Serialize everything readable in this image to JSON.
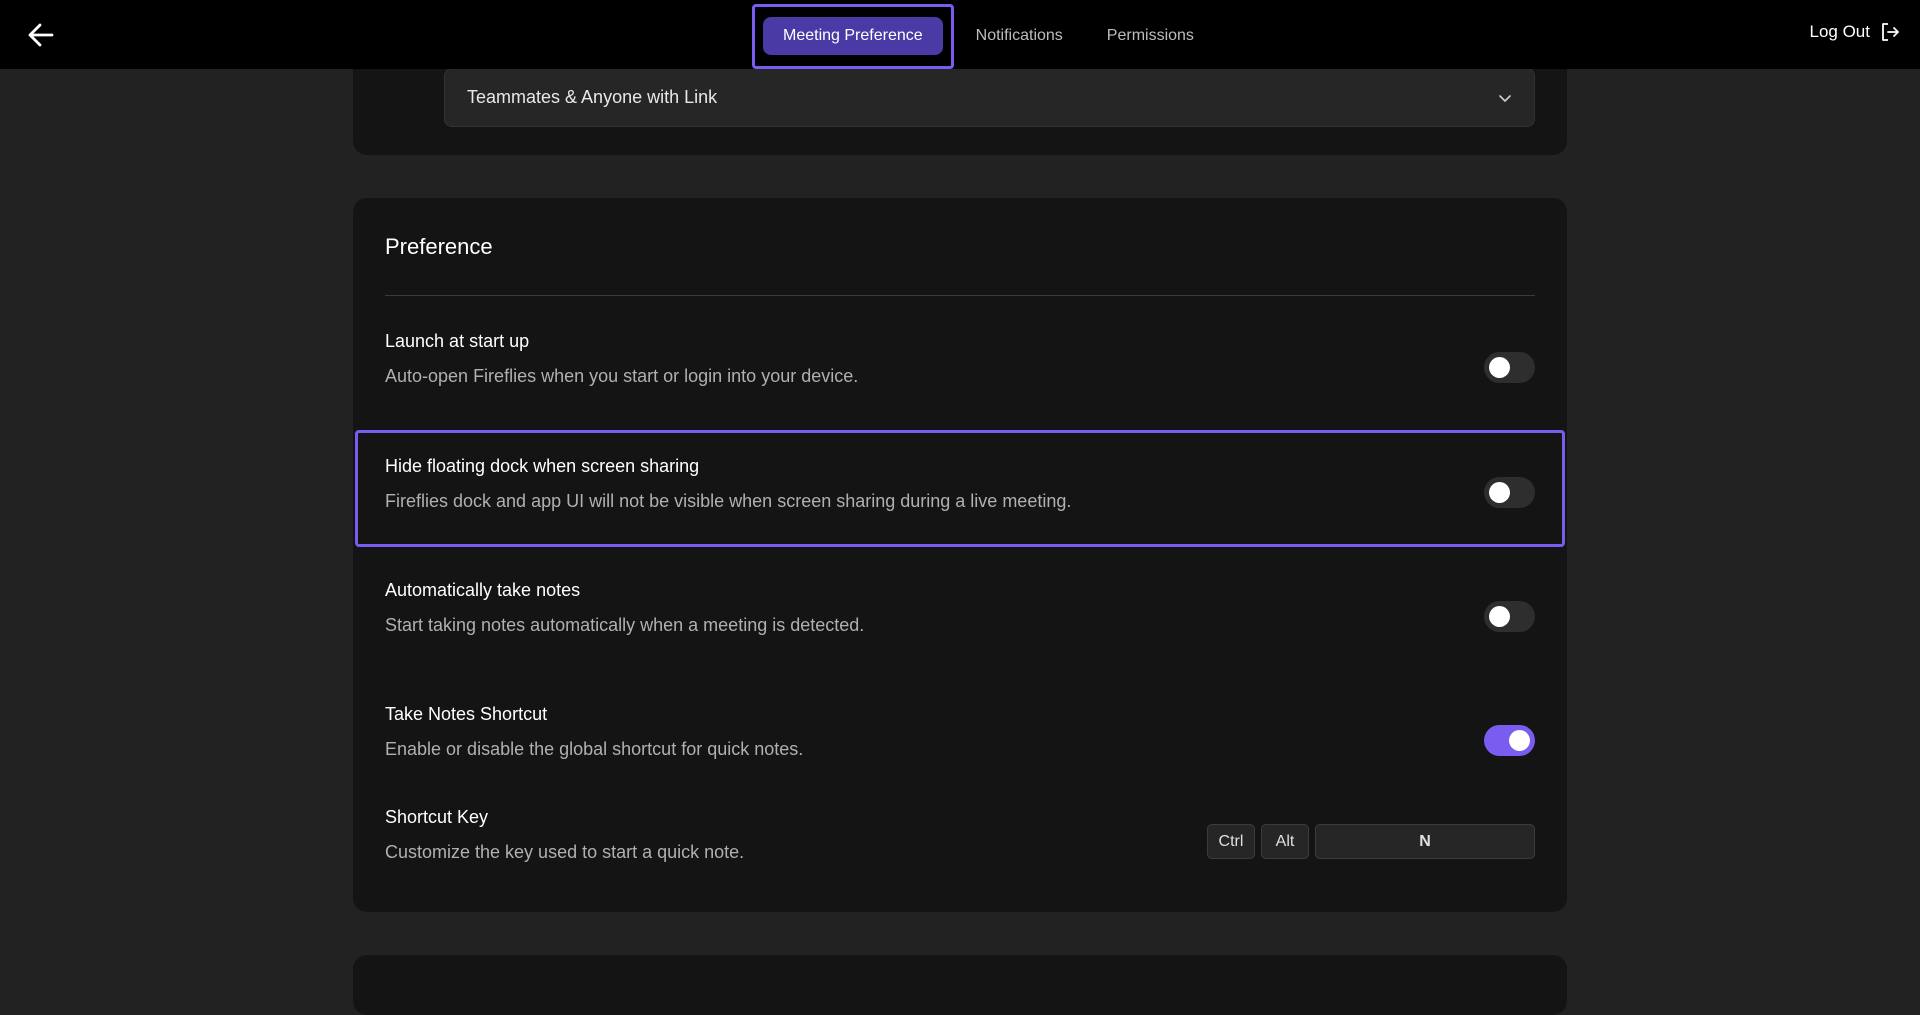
{
  "header": {
    "tabs": [
      {
        "label": "Meeting Preference",
        "active": true
      },
      {
        "label": "Notifications",
        "active": false
      },
      {
        "label": "Permissions",
        "active": false
      }
    ],
    "logout_label": "Log Out"
  },
  "sharing": {
    "selected": "Teammates & Anyone with Link"
  },
  "preference": {
    "title": "Preference",
    "rows": [
      {
        "title": "Launch at start up",
        "desc": "Auto-open Fireflies when you start or login into your device.",
        "enabled": false
      },
      {
        "title": "Hide floating dock when screen sharing",
        "desc": "Fireflies dock and app UI will not be visible when screen sharing during a live meeting.",
        "enabled": false
      },
      {
        "title": "Automatically take notes",
        "desc": "Start taking notes automatically when a meeting is detected.",
        "enabled": false
      },
      {
        "title": "Take Notes Shortcut",
        "desc": "Enable or disable the global shortcut for quick notes.",
        "enabled": true
      }
    ],
    "shortcut": {
      "title": "Shortcut Key",
      "desc": "Customize the key used to start a quick note.",
      "modifiers": [
        "Ctrl",
        "Alt"
      ],
      "key": "N"
    }
  },
  "colors": {
    "accent": "#7b5cf0",
    "active_tab_bg": "#4a3aa6",
    "card_bg": "#141414",
    "page_bg": "#222222"
  }
}
